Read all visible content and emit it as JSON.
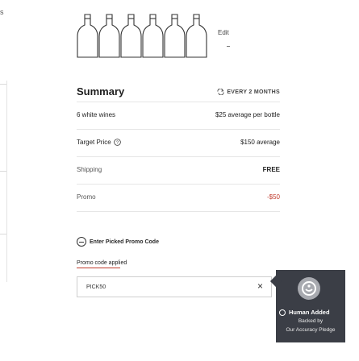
{
  "edge_label": "s",
  "bottles": {
    "count": 6,
    "edit_label": "Edit"
  },
  "summary": {
    "title": "Summary",
    "frequency": "EVERY 2 MONTHS",
    "rows": [
      {
        "label": "6 white wines",
        "value": "$25 average per bottle",
        "help": false,
        "style": "normal"
      },
      {
        "label": "Target Price",
        "value": "$150 average",
        "help": true,
        "style": "normal"
      },
      {
        "label": "Shipping",
        "value": "FREE",
        "help": false,
        "style": "bold"
      },
      {
        "label": "Promo",
        "value": "-$50",
        "help": false,
        "style": "red"
      }
    ]
  },
  "promo": {
    "toggle_label": "Enter Picked Promo Code",
    "applied_label": "Promo code applied",
    "code": "PICK50",
    "remove_glyph": "×"
  },
  "trust": {
    "title": "Human Added",
    "line1": "Backed by",
    "line2": "Our Accuracy Pledge"
  },
  "colors": {
    "promo_red": "#c0392b",
    "trust_bg": "#3b3e46"
  }
}
